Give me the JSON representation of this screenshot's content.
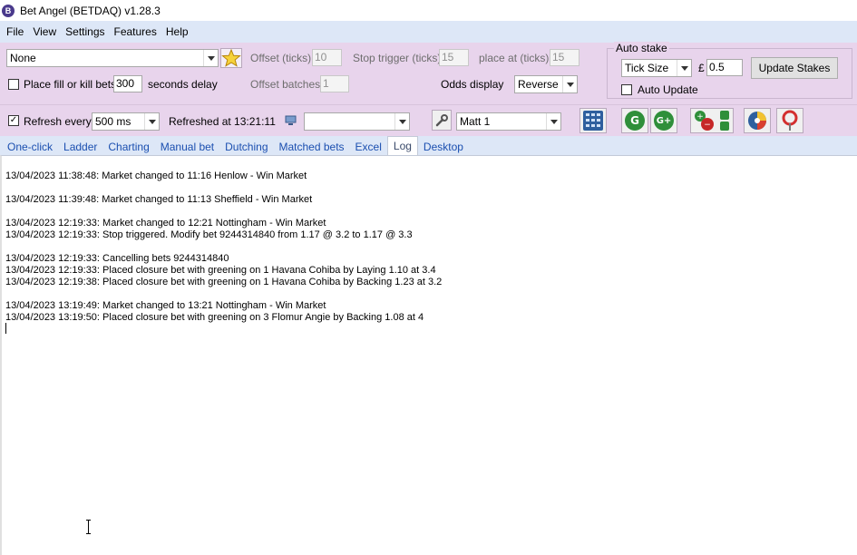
{
  "window": {
    "title": "Bet Angel (BETDAQ) v1.28.3",
    "logo_letter": "B"
  },
  "menu": [
    "File",
    "View",
    "Settings",
    "Features",
    "Help"
  ],
  "settings": {
    "market_select_value": "None",
    "place_fill_kill_label": "Place fill or kill bets",
    "place_fill_kill_checked": false,
    "delay_value": "300",
    "seconds_delay_label": "seconds delay",
    "offset_ticks_label": "Offset (ticks)",
    "offset_ticks_value": "10",
    "stop_trigger_label": "Stop trigger (ticks)",
    "stop_trigger_value": "15",
    "place_at_label": "place at (ticks)",
    "place_at_value": "15",
    "offset_batches_label": "Offset batches",
    "offset_batches_value": "1",
    "odds_display_label": "Odds display",
    "odds_display_value": "Reverse"
  },
  "auto_stake": {
    "group_title": "Auto stake",
    "mode_value": "Tick Size",
    "currency": "£",
    "amount": "0.5",
    "update_button": "Update Stakes",
    "auto_update_label": "Auto Update",
    "auto_update_checked": false
  },
  "toolbar": {
    "refresh_label": "Refresh every",
    "refresh_checked": true,
    "refresh_value": "500 ms",
    "refreshed_at": "Refreshed at 13:21:11",
    "profile_value": "",
    "user_value": "Matt 1",
    "green_label": "G",
    "green_plus_label": "G+"
  },
  "tabs": [
    "One-click",
    "Ladder",
    "Charting",
    "Manual bet",
    "Dutching",
    "Matched bets",
    "Excel",
    "Log",
    "Desktop"
  ],
  "active_tab": "Log",
  "log": [
    "13/04/2023 11:38:48:  Market changed to 11:16 Henlow - Win Market",
    "13/04/2023 11:39:48:  Market changed to 11:13 Sheffield - Win Market",
    "13/04/2023 12:19:33:  Market changed to 12:21 Nottingham - Win Market",
    "13/04/2023 12:19:33:  Stop triggered. Modify bet 9244314840 from 1.17 @ 3.2  to  1.17 @ 3.3",
    "13/04/2023 12:19:33:  Cancelling bets 9244314840",
    "13/04/2023 12:19:33:  Placed closure bet with greening on 1 Havana Cohiba by Laying 1.10 at 3.4",
    "13/04/2023 12:19:38:  Placed closure bet with greening on 1 Havana Cohiba by Backing 1.23 at 3.2",
    "13/04/2023 13:19:49:  Market changed to 13:21 Nottingham - Win Market",
    "13/04/2023 13:19:50:  Placed closure bet with greening on 3 Flomur Angie by Backing 1.08 at 4"
  ],
  "colors": {
    "menu_bg": "#dde7f7",
    "panel_bg": "#e8d4ec",
    "tab_text": "#1b4fb0"
  }
}
